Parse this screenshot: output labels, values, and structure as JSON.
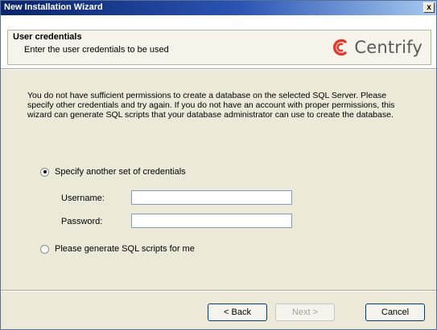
{
  "window": {
    "title": "New Installation Wizard",
    "close_label": "x"
  },
  "header": {
    "title": "User credentials",
    "subtitle": "Enter the user credentials to be used",
    "logo_text": "Centrify",
    "logo_color": "#e03a2f"
  },
  "body": {
    "message": "You do not have sufficient permissions to create a database on the selected SQL Server. Please specify other credentials and try again. If you do not have an account with proper permissions, this wizard can generate SQL scripts that your database administrator can use to create the database.",
    "option_credentials": "Specify another set of credentials",
    "option_credentials_selected": true,
    "username_label": "Username:",
    "username_value": "",
    "password_label": "Password:",
    "password_value": "",
    "option_scripts": "Please generate SQL scripts for me",
    "option_scripts_selected": false
  },
  "buttons": {
    "back": "< Back",
    "next": "Next >",
    "cancel": "Cancel"
  }
}
